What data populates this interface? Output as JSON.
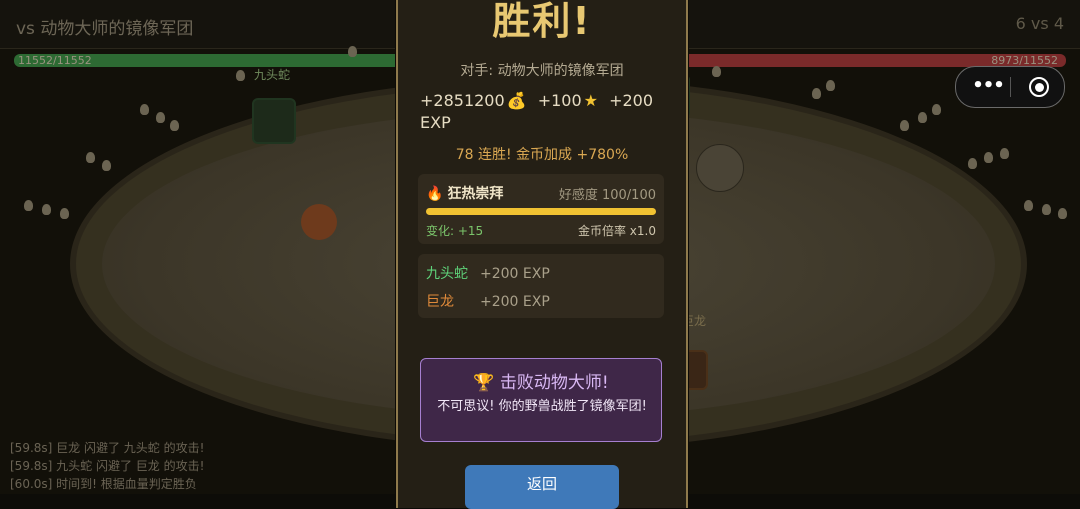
{
  "battle": {
    "title": "vs 动物大师的镜像军团",
    "score": "6 vs 4",
    "hp_left": "11552/11552",
    "hp_right": "8973/11552",
    "unit_left_label": "九头蛇",
    "unit_right_label": "巨龙",
    "log": [
      "[59.8s] 巨龙 闪避了 九头蛇 的攻击!",
      "[59.8s] 九头蛇 闪避了 巨龙 的攻击!",
      "[60.0s] 时间到! 根据血量判定胜负"
    ]
  },
  "result": {
    "title": "胜利!",
    "opponent": "对手: 动物大师的镜像军团",
    "rewards": {
      "gold": "+2851200",
      "gold_icon": "💰",
      "stars": "+100",
      "star_icon": "★",
      "exp": "+200 EXP"
    },
    "streak": "78 连胜! 金币加成 +780%",
    "favor": {
      "icon": "fire-icon",
      "level": "狂热崇拜",
      "score": "好感度 100/100",
      "fill_fraction": 1.0,
      "change": "变化: +15",
      "multiplier": "金币倍率 x1.0"
    },
    "exp_gains": [
      {
        "name": "九头蛇",
        "exp": "+200 EXP",
        "color": "#5fd37a"
      },
      {
        "name": "巨龙",
        "exp": "+200 EXP",
        "color": "#e08a3a"
      }
    ],
    "achievement": {
      "title": "击败动物大师!",
      "desc": "不可思议! 你的野兽战胜了镜像军团!"
    },
    "back_label": "返回"
  },
  "capsule": {
    "more_label": "•••"
  }
}
